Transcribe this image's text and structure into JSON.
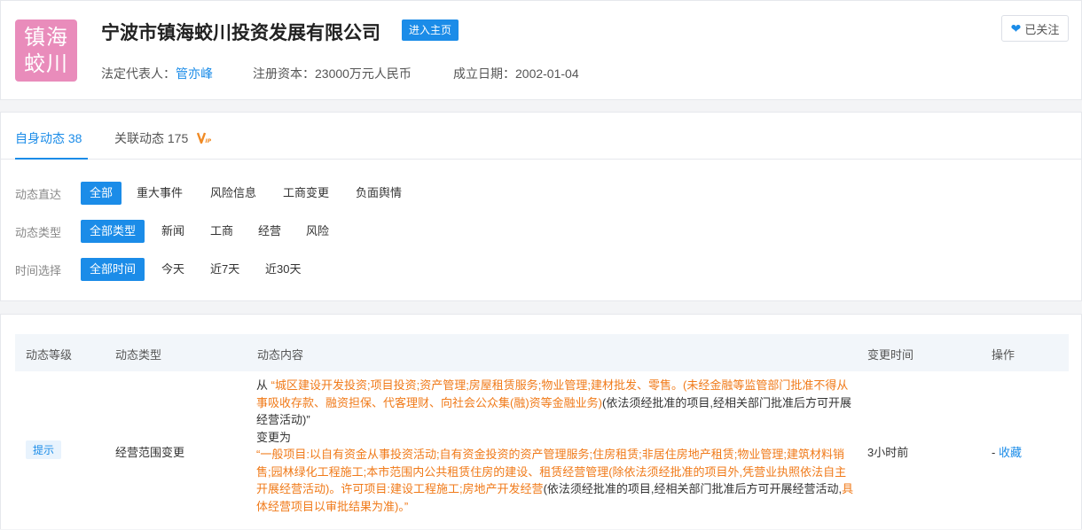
{
  "company": {
    "logo_line1": "镇海",
    "logo_line2": "蛟川",
    "name": "宁波市镇海蛟川投资发展有限公司",
    "homepage_label": "进入主页",
    "legal_rep_label": "法定代表人：",
    "legal_rep": "管亦峰",
    "capital_label": "注册资本：",
    "capital": "23000万元人民币",
    "founded_label": "成立日期：",
    "founded": "2002-01-04",
    "follow_label": "已关注"
  },
  "tabs": [
    {
      "label": "自身动态",
      "count": "38"
    },
    {
      "label": "关联动态",
      "count": "175",
      "badge": "VIP"
    }
  ],
  "filters": [
    {
      "label": "动态直达",
      "options": [
        "全部",
        "重大事件",
        "风险信息",
        "工商变更",
        "负面舆情"
      ],
      "selected": 0
    },
    {
      "label": "动态类型",
      "options": [
        "全部类型",
        "新闻",
        "工商",
        "经营",
        "风险"
      ],
      "selected": 0
    },
    {
      "label": "时间选择",
      "options": [
        "全部时间",
        "今天",
        "近7天",
        "近30天"
      ],
      "selected": 0
    }
  ],
  "table": {
    "headers": [
      "动态等级",
      "动态类型",
      "动态内容",
      "变更时间",
      "操作"
    ],
    "rows": [
      {
        "level": "提示",
        "type": "经营范围变更",
        "from_prefix": "从",
        "from_text": "“城区建设开发投资;项目投资;资产管理;房屋租赁服务;物业管理;建材批发、零售。(未经金融等监管部门批准不得从事吸收存款、融资担保、代客理财、向社会公众集(融)资等金融业务)",
        "from_suffix": "(依法须经批准的项目,经相关部门批准后方可开展经营活动)”",
        "changed_to": "变更为",
        "to_text": "“一般项目:以自有资金从事投资活动;自有资金投资的资产管理服务;住房租赁;非居住房地产租赁;物业管理;建筑材料销售;园林绿化工程施工;本市范围内公共租赁住房的建设、租赁经营管理(除依法须经批准的项目外,凭营业执照依法自主开展经营活动)。许可项目:建设工程施工;房地产开发经营",
        "to_mid": "(依法须经批准的项目,经相关部门批准后方可开展经营活动,",
        "to_end": "具体经营项目以审批结果为准)。”",
        "time": "3小时前",
        "action_dash": "-",
        "action": "收藏"
      }
    ]
  },
  "colors": {
    "accent": "#1b8ce8",
    "highlight": "#f07a19",
    "logo_bg": "#e98cbb"
  }
}
